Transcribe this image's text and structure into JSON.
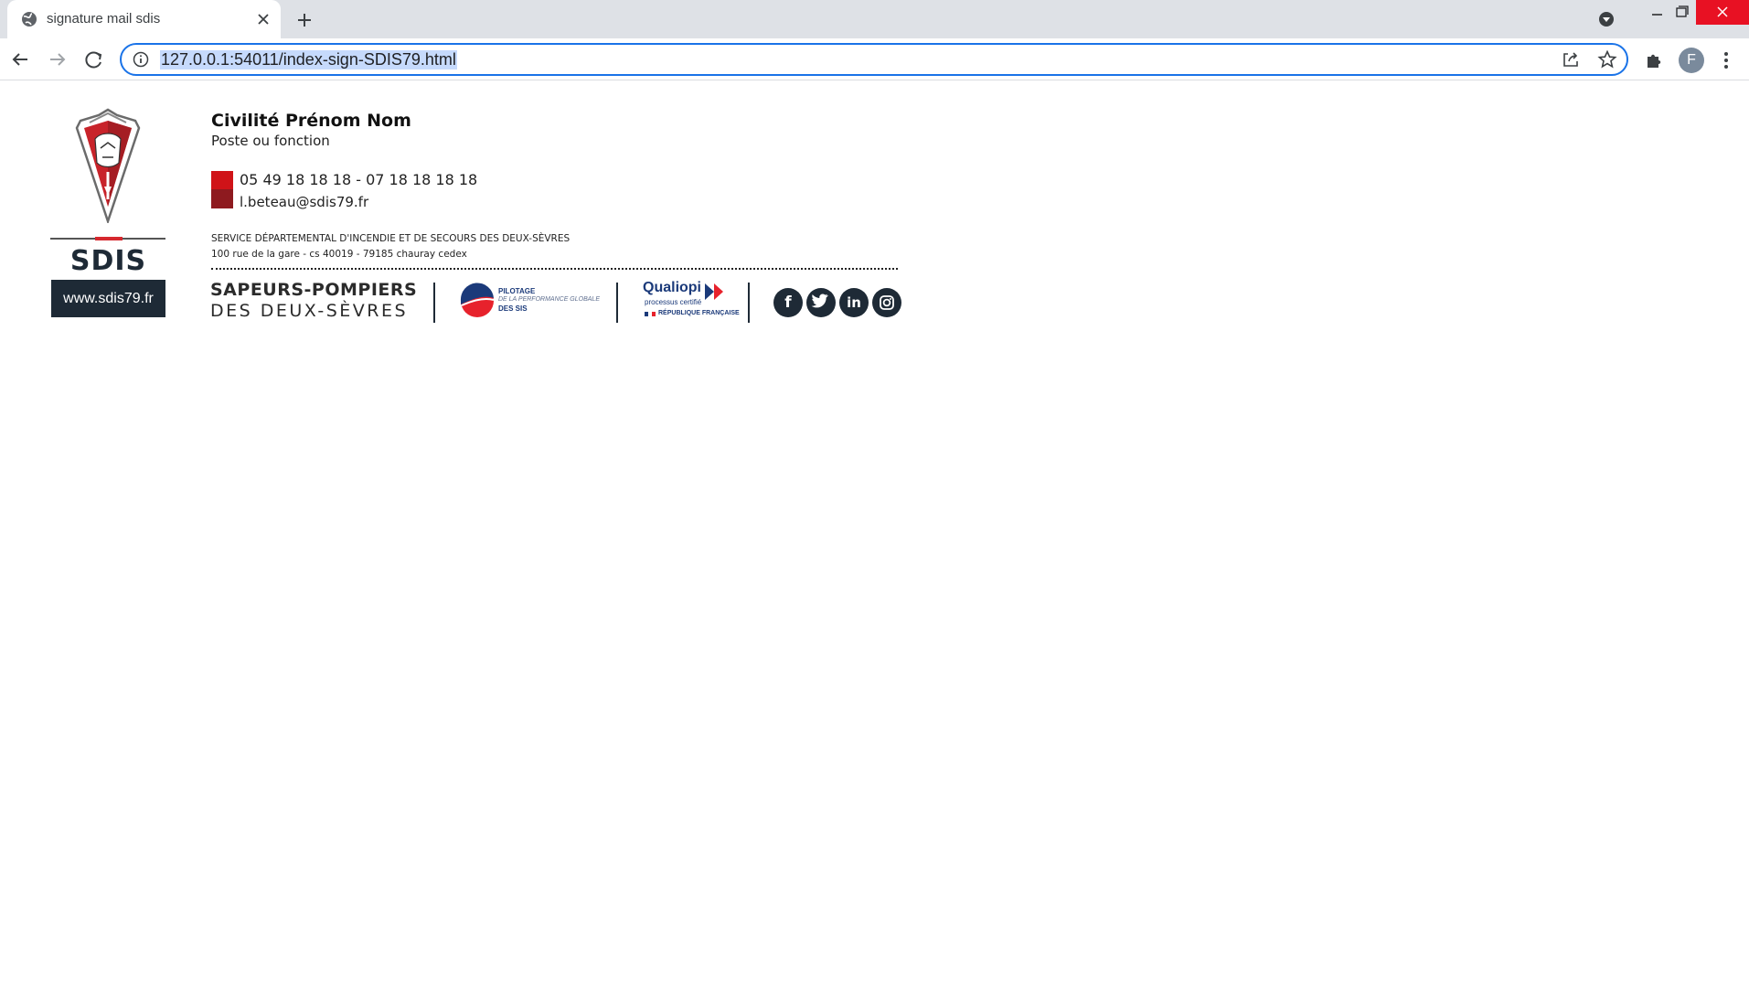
{
  "browser": {
    "tab_title": "signature mail sdis",
    "url": "127.0.0.1:54011/index-sign-SDIS79.html",
    "profile_initial": "F"
  },
  "signature": {
    "name": "Civilité Prénom Nom",
    "role": "Poste ou fonction",
    "phone": "05 49 18 18 18 - 07 18 18 18 18",
    "email": "l.beteau@sdis79.fr",
    "organization": "SERVICE DÉPARTEMENTAL D'INCENDIE ET DE SECOURS DES DEUX-SÈVRES",
    "address": "100 rue de la gare - cs 40019 - 79185 chauray cedex",
    "logo_title": "SDIS 79",
    "website": "www.sdis79.fr",
    "sapeurs_line1": "SAPEURS-POMPIERS",
    "sapeurs_line2": "DES DEUX-SÈVRES",
    "pilotage_line1": "PILOTAGE",
    "pilotage_line2": "DE LA PERFORMANCE GLOBALE",
    "pilotage_line3": "DES SIS",
    "qualiopi_title": "Qualiopi",
    "qualiopi_sub": "processus certifié",
    "qualiopi_rep": "RÉPUBLIQUE FRANÇAISE",
    "social": [
      {
        "name": "facebook-icon",
        "glyph": "f"
      },
      {
        "name": "twitter-icon",
        "glyph": ""
      },
      {
        "name": "linkedin-icon",
        "glyph": "in"
      },
      {
        "name": "instagram-icon",
        "glyph": ""
      }
    ]
  },
  "colors": {
    "accent_red": "#d01318",
    "dark_red": "#8e1a1f",
    "navy": "#1e2a36",
    "omnibox_focus": "#1a73e8"
  }
}
